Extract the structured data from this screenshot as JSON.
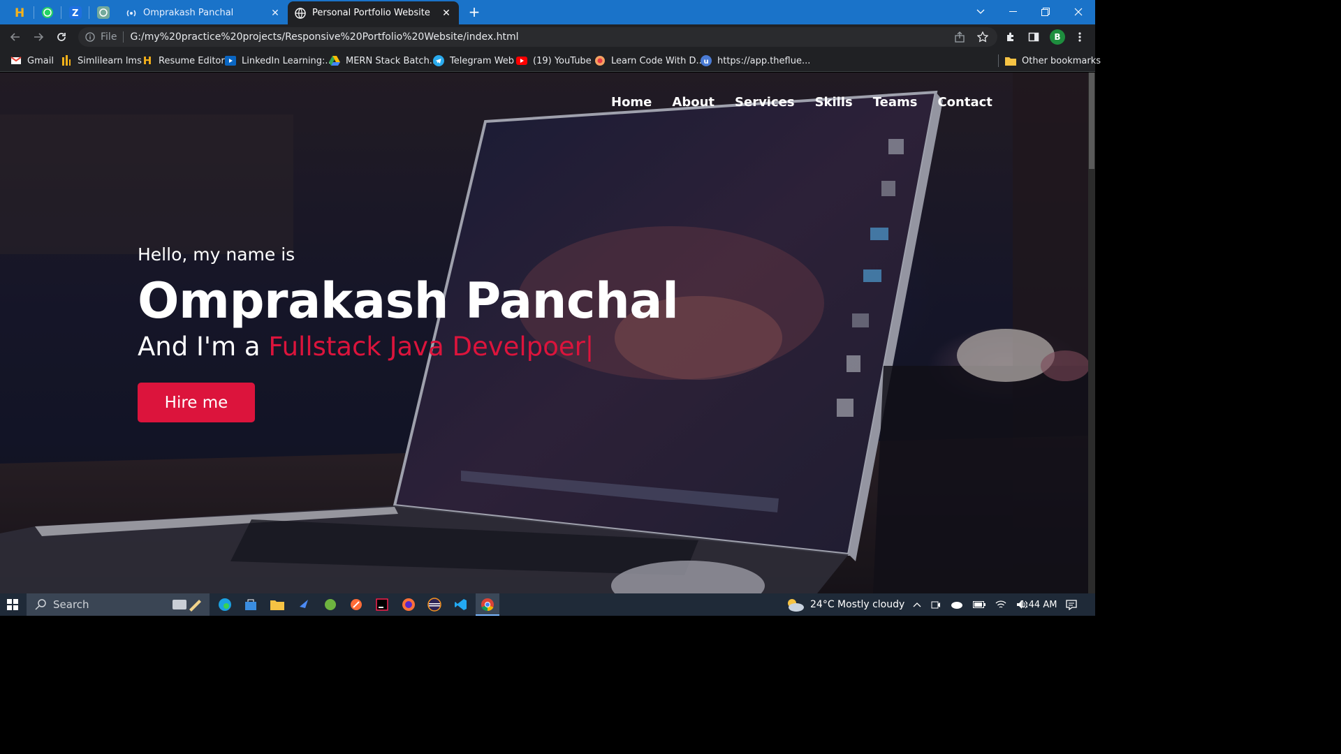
{
  "browser": {
    "tabs": [
      {
        "title": "Omprakash Panchal"
      },
      {
        "title": "Personal Portfolio Website"
      }
    ],
    "address": {
      "scheme": "File",
      "url": "G:/my%20practice%20projects/Responsive%20Portfolio%20Website/index.html"
    },
    "profile_initial": "B",
    "bookmarks": [
      {
        "label": "Gmail"
      },
      {
        "label": "Simlilearn lms"
      },
      {
        "label": "Resume Editor"
      },
      {
        "label": "LinkedIn Learning:..."
      },
      {
        "label": "MERN Stack Batch..."
      },
      {
        "label": "Telegram Web"
      },
      {
        "label": "(19) YouTube"
      },
      {
        "label": "Learn Code With D..."
      },
      {
        "label": "https://app.theflue..."
      }
    ],
    "other_bookmarks": "Other bookmarks"
  },
  "site": {
    "nav": [
      "Home",
      "About",
      "Services",
      "Skills",
      "Teams",
      "Contact"
    ],
    "hero": {
      "greeting": "Hello, my name is",
      "name": "Omprakash Panchal",
      "role_prefix": "And I'm a",
      "role_typed": "Fullstack Java Develpoer|",
      "cta": "Hire me"
    },
    "colors": {
      "accent": "#dc143c"
    }
  },
  "taskbar": {
    "search_placeholder": "Search",
    "weather": "24°C  Mostly cloudy",
    "time": "1:44 AM"
  }
}
